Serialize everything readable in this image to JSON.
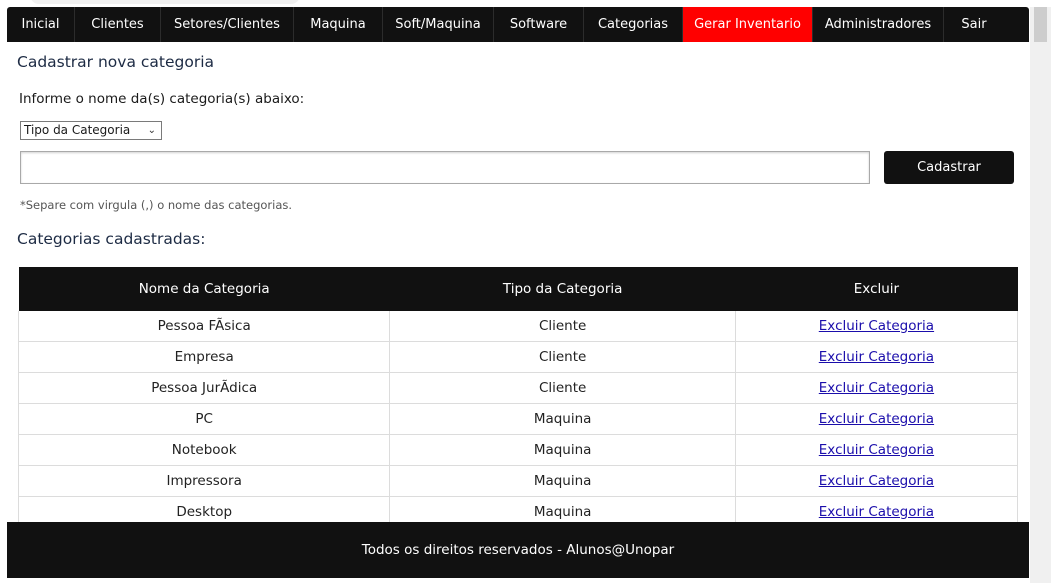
{
  "nav": {
    "items": [
      {
        "label": "Inicial",
        "active": false
      },
      {
        "label": "Clientes",
        "active": false
      },
      {
        "label": "Setores/Clientes",
        "active": false
      },
      {
        "label": "Maquina",
        "active": false
      },
      {
        "label": "Soft/Maquina",
        "active": false
      },
      {
        "label": "Software",
        "active": false
      },
      {
        "label": "Categorias",
        "active": false
      },
      {
        "label": "Gerar Inventario",
        "active": true
      },
      {
        "label": "Administradores",
        "active": false
      },
      {
        "label": "Sair",
        "active": false
      }
    ]
  },
  "form": {
    "title": "Cadastrar nova categoria",
    "instruction": "Informe o nome da(s) categoria(s) abaixo:",
    "select_value": "Tipo da Categoria",
    "input_value": "",
    "submit_label": "Cadastrar",
    "hint": "*Separe com virgula (,) o nome das categorias."
  },
  "table": {
    "heading": "Categorias cadastradas:",
    "columns": [
      "Nome da Categoria",
      "Tipo da Categoria",
      "Excluir"
    ],
    "rows": [
      {
        "name": "Pessoa FÃsica",
        "type": "Cliente",
        "action": "Excluir Categoria"
      },
      {
        "name": "Empresa",
        "type": "Cliente",
        "action": "Excluir Categoria"
      },
      {
        "name": "Pessoa JurÃdica",
        "type": "Cliente",
        "action": "Excluir Categoria"
      },
      {
        "name": "PC",
        "type": "Maquina",
        "action": "Excluir Categoria"
      },
      {
        "name": "Notebook",
        "type": "Maquina",
        "action": "Excluir Categoria"
      },
      {
        "name": "Impressora",
        "type": "Maquina",
        "action": "Excluir Categoria"
      },
      {
        "name": "Desktop",
        "type": "Maquina",
        "action": "Excluir Categoria"
      }
    ]
  },
  "footer": {
    "text": "Todos os direitos reservados - Alunos@Unopar"
  },
  "colors": {
    "nav_bg": "#111111",
    "active": "#ff0000",
    "link": "#1a0dab"
  }
}
